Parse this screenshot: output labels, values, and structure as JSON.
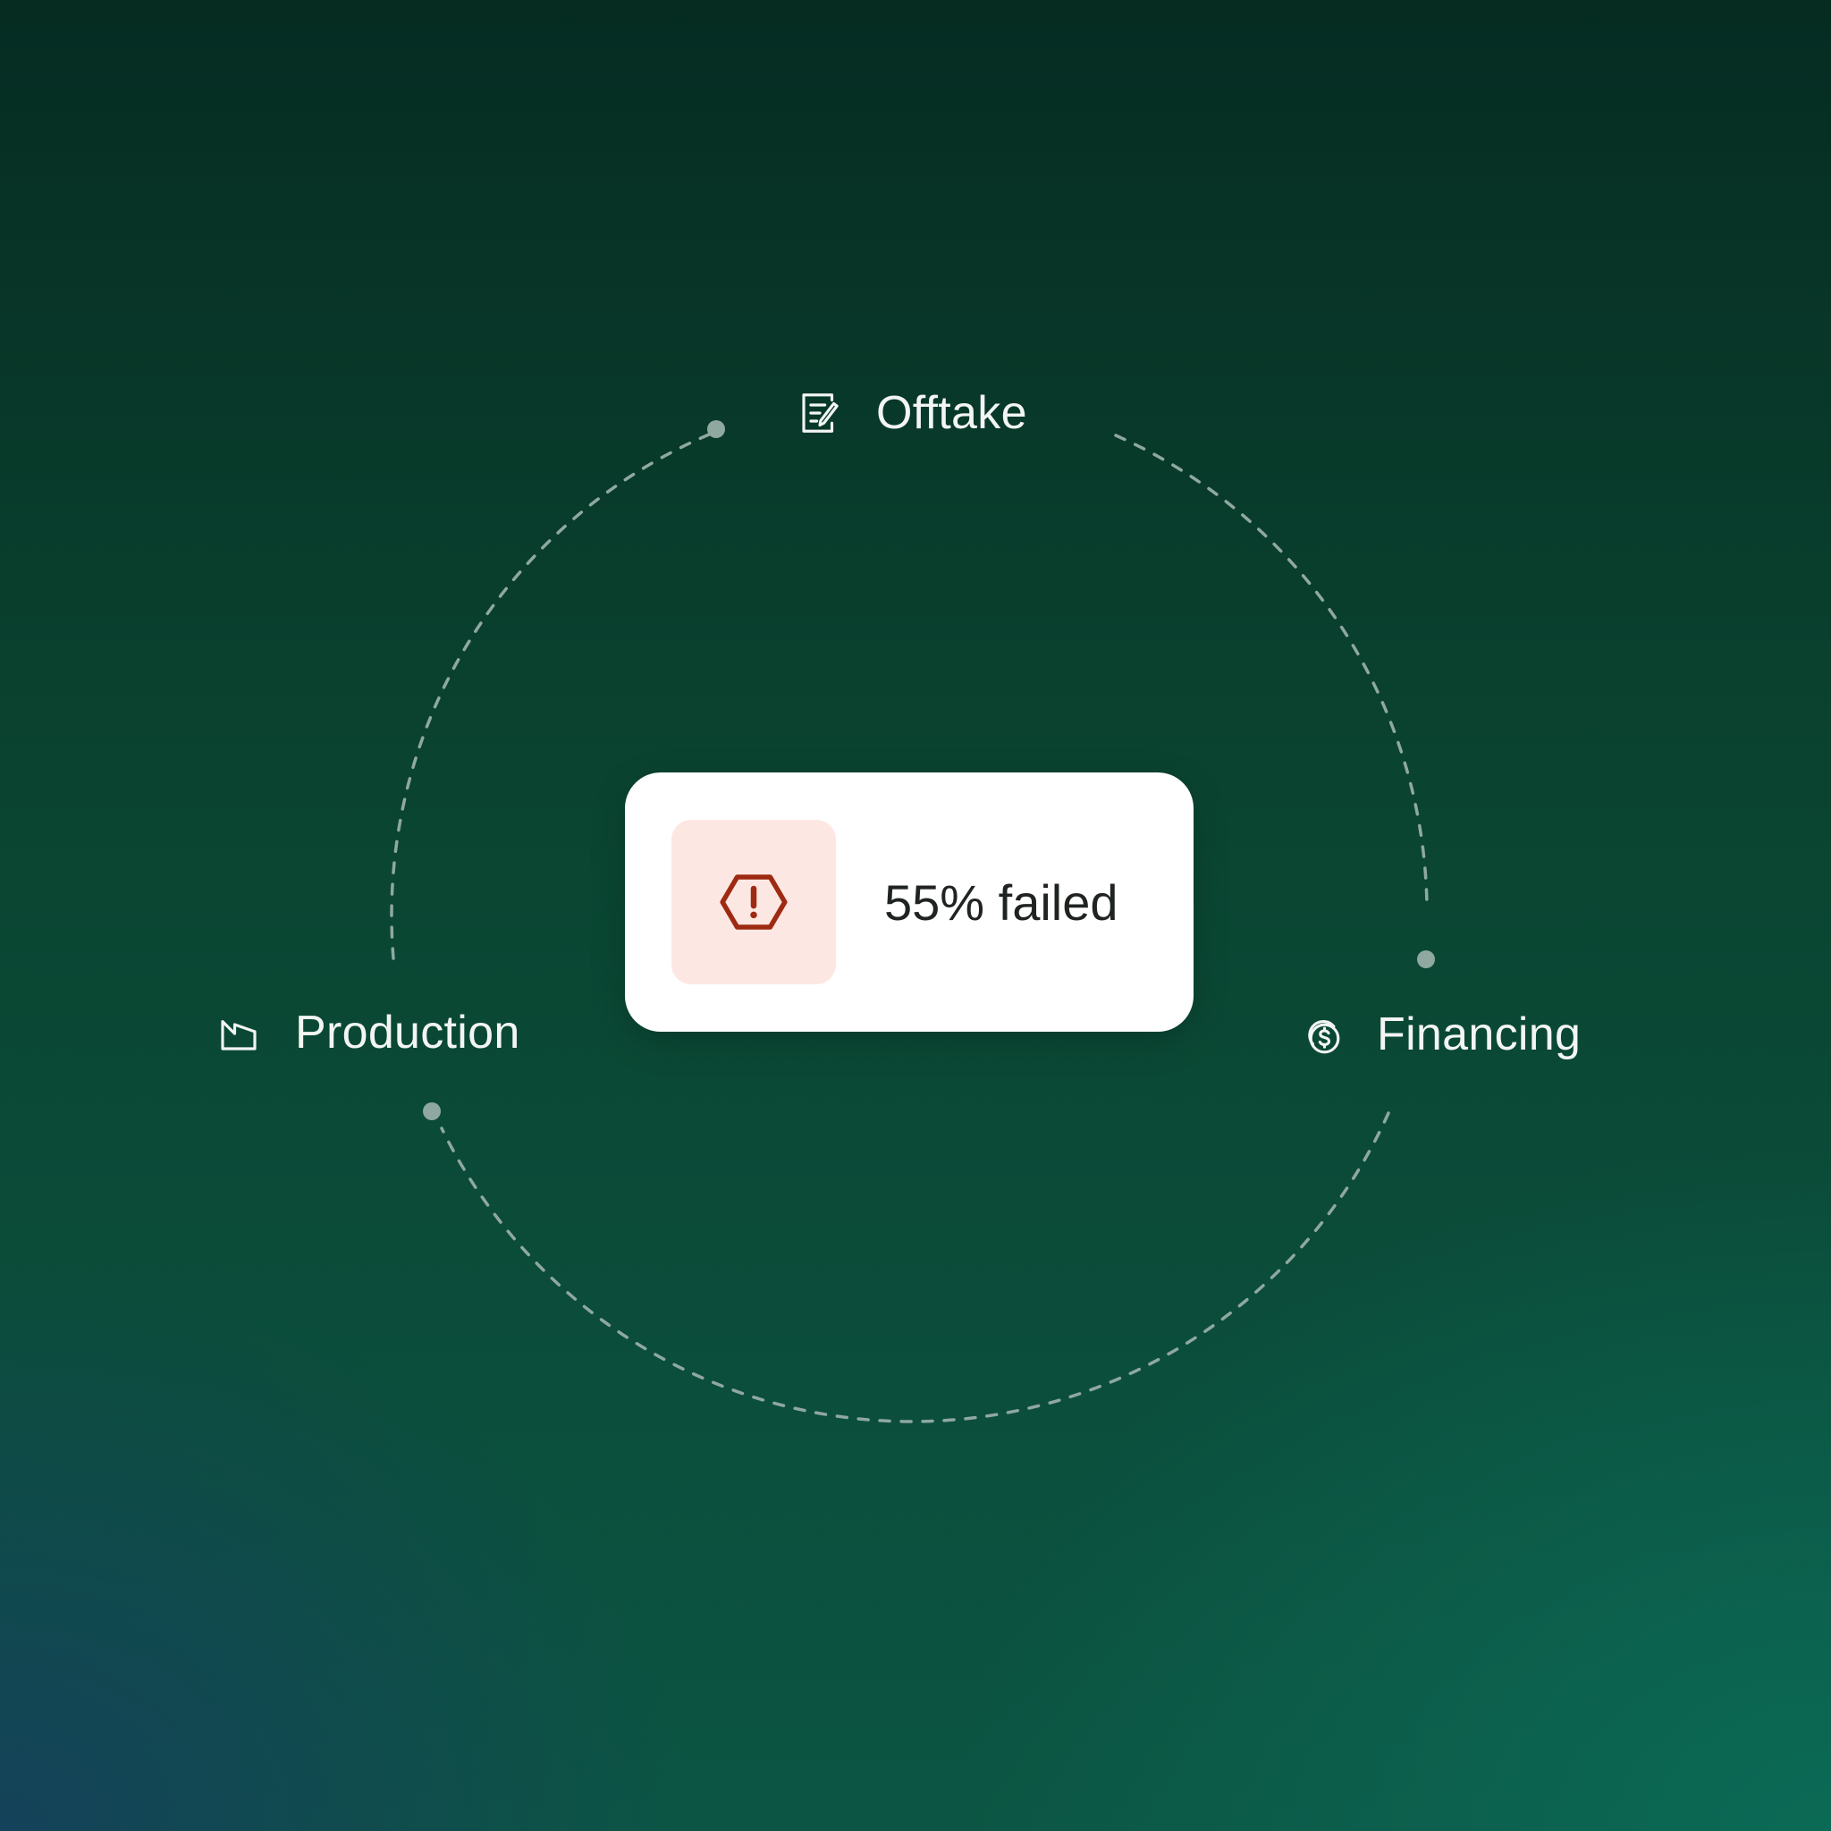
{
  "nodes": {
    "offtake": {
      "label": "Offtake",
      "icon": "document-edit-icon"
    },
    "production": {
      "label": "Production",
      "icon": "factory-icon"
    },
    "financing": {
      "label": "Financing",
      "icon": "coins-icon"
    }
  },
  "status_card": {
    "text": "55% failed",
    "icon": "warning-hexagon-icon",
    "icon_color": "#9e2a12",
    "icon_bg": "#fde7e3"
  },
  "colors": {
    "connector": "#8fa8a0",
    "label_text": "#f2f5f3"
  }
}
